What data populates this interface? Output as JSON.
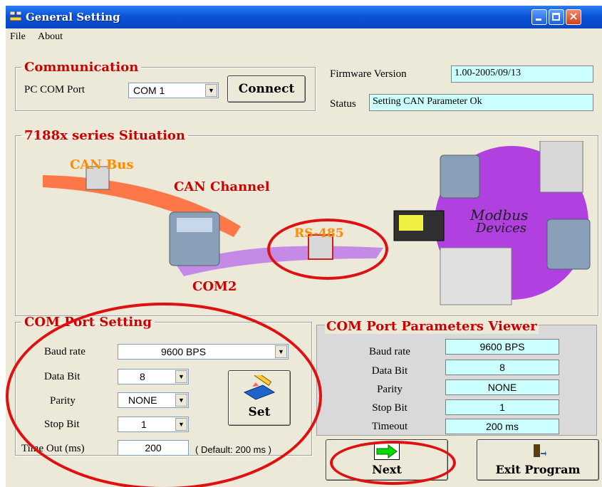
{
  "window": {
    "title": "General Setting"
  },
  "menu": {
    "file": "File",
    "about": "About"
  },
  "communication": {
    "legend": "Communication",
    "pc_com_port_label": "PC COM Port",
    "pc_com_port_value": "COM 1",
    "connect_label": "Connect",
    "firmware_label": "Firmware Version",
    "firmware_value": "1.00-2005/09/13",
    "status_label": "Status",
    "status_value": "Setting CAN Parameter Ok"
  },
  "situation": {
    "legend": "7188x series Situation",
    "can_bus": "CAN Bus",
    "can_channel": "CAN Channel",
    "rs485": "RS-485",
    "com2": "COM2",
    "modbus_line1": "Modbus",
    "modbus_line2": "Devices"
  },
  "com_setting": {
    "legend": "COM Port Setting",
    "baud_label": "Baud rate",
    "baud_value": "9600  BPS",
    "databit_label": "Data Bit",
    "databit_value": "8",
    "parity_label": "Parity",
    "parity_value": "NONE",
    "stopbit_label": "Stop Bit",
    "stopbit_value": "1",
    "timeout_label": "Time Out (ms)",
    "timeout_value": "200",
    "default_note": "( Default: 200 ms )",
    "set_label": "Set"
  },
  "viewer": {
    "title": "COM Port Parameters Viewer",
    "rows": [
      {
        "label": "Baud rate",
        "value": "9600  BPS"
      },
      {
        "label": "Data Bit",
        "value": "8"
      },
      {
        "label": "Parity",
        "value": "NONE"
      },
      {
        "label": "Stop Bit",
        "value": "1"
      },
      {
        "label": "Timeout",
        "value": "200 ms"
      }
    ]
  },
  "buttons": {
    "next": "Next",
    "exit": "Exit Program"
  },
  "colors": {
    "accent_red": "#cc0000",
    "orange": "#ff8c00",
    "cyan_box": "#ccffff",
    "highlight_ring": "#e01010"
  }
}
